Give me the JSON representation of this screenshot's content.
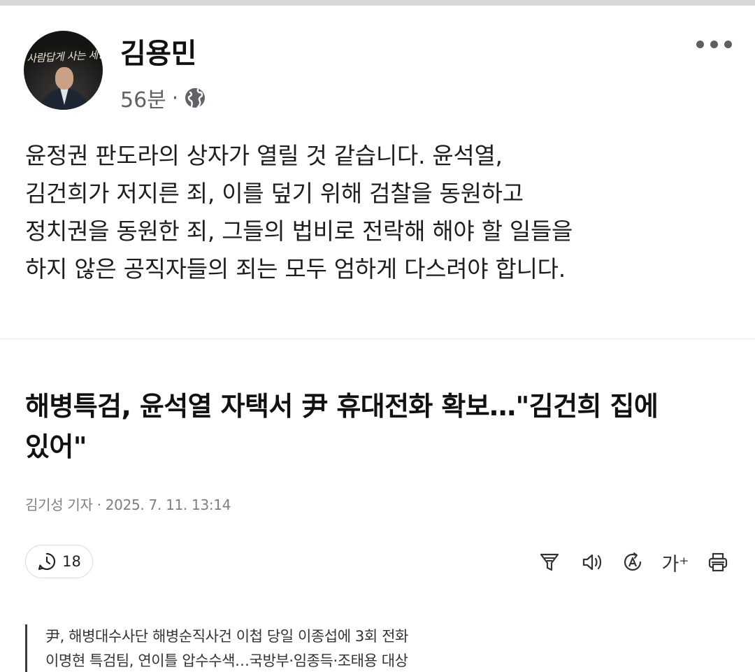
{
  "post": {
    "author": "김용민",
    "time": "56분",
    "separator": "·",
    "privacy_icon": "globe-icon",
    "more_icon": "more-options-icon",
    "body_lines": [
      "윤정권 판도라의 상자가 열릴 것 같습니다. 윤석열,",
      "김건희가 저지른 죄, 이를 덮기 위해 검찰을 동원하고",
      "정치권을 동원한 죄, 그들의 법비로 전락해 해야 할 일들을",
      "하지 않은 공직자들의 죄는 모두 엄하게 다스려야 합니다."
    ]
  },
  "article": {
    "headline_lines": [
      "해병특검, 윤석열 자택서 尹 휴대전화 확보…\"김건희 집에",
      "있어\""
    ],
    "byline": "김기성 기자 · 2025. 7. 11. 13:14",
    "comment_count": "18",
    "tools": {
      "summary_icon": "summary-filter-icon",
      "listen_icon": "speaker-icon",
      "translate_icon": "translate-icon",
      "font_size_label": "가⁺",
      "print_icon": "printer-icon"
    },
    "summary_lines": [
      "尹, 해병대수사단 해병순직사건 이첩 당일 이종섭에 3회 전화",
      "이명현 특검팀, 연이틀 압수수색…국방부·임종득·조태용 대상"
    ]
  }
}
